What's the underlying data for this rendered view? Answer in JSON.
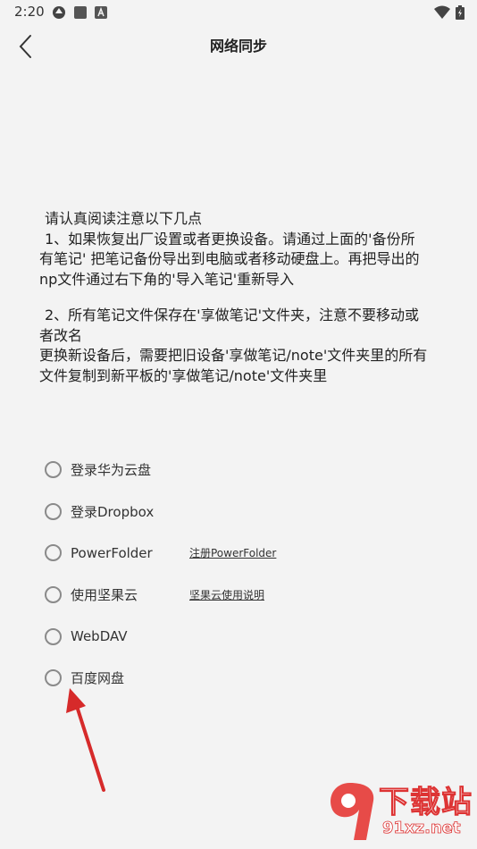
{
  "status_bar": {
    "time": "2:20"
  },
  "header": {
    "title": "网络同步"
  },
  "notice": {
    "heading": "请认真阅读注意以下几点",
    "item1_line1": "1、如果恢复出厂设置或者更换设备。请通过上面的'备份所",
    "item1_line2": "有笔记' 把笔记备份导出到电脑或者移动硬盘上。再把导出的",
    "item1_line3": "np文件通过右下角的'导入笔记'重新导入",
    "item2_line1": "2、所有笔记文件保存在'享做笔记'文件夹，注意不要移动或",
    "item2_line2": "者改名",
    "item2_line3": "更换新设备后，需要把旧设备'享做笔记/note'文件夹里的所有",
    "item2_line4": "文件复制到新平板的'享做笔记/note'文件夹里"
  },
  "options": [
    {
      "label": "登录华为云盘",
      "link": ""
    },
    {
      "label": "登录Dropbox",
      "link": ""
    },
    {
      "label": "PowerFolder",
      "link": "注册PowerFolder"
    },
    {
      "label": "使用坚果云",
      "link": "坚果云使用说明"
    },
    {
      "label": "WebDAV",
      "link": ""
    },
    {
      "label": "百度网盘",
      "link": ""
    }
  ],
  "watermark": {
    "title": "下载站",
    "url": "91xz.net"
  },
  "colors": {
    "background": "#f3f3f3",
    "radio_border": "#8a8a8a",
    "arrow": "#d62a2a"
  }
}
